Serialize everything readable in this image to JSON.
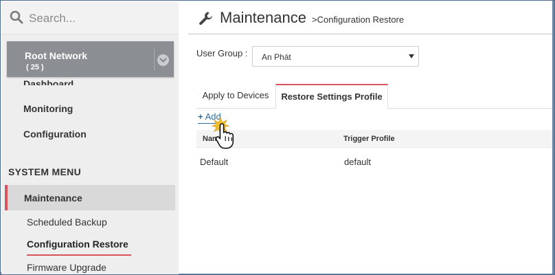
{
  "search": {
    "placeholder": "Search..."
  },
  "network": {
    "name": "Root Network",
    "count": "( 25 )"
  },
  "nav": {
    "dashboard": "Dashboard",
    "monitoring": "Monitoring",
    "configuration": "Configuration"
  },
  "system_menu": {
    "heading": "SYSTEM MENU",
    "maintenance": "Maintenance",
    "items": [
      "Scheduled Backup",
      "Configuration Restore",
      "Firmware Upgrade"
    ],
    "active_index": 1
  },
  "header": {
    "title": "Maintenance",
    "breadcrumb": ">Configuration Restore"
  },
  "user_group": {
    "label": "User Group :",
    "selected": "An Phát"
  },
  "tabs": [
    {
      "label": "Apply to Devices",
      "active": false
    },
    {
      "label": "Restore Settings Profile",
      "active": true
    }
  ],
  "add_label": "Add",
  "table": {
    "columns": [
      "Name",
      "Trigger Profile"
    ],
    "rows": [
      [
        "Default",
        "default"
      ]
    ]
  },
  "colors": {
    "accent": "#d9535f",
    "link": "#2d6b9f",
    "network_bg": "#8b8f94",
    "sidebar_bg": "#eeeeee"
  },
  "icons": {
    "search": "search-icon",
    "chevron": "chevron-down-circle-icon",
    "wrench": "wrench-icon",
    "caret": "caret-down-icon",
    "cursor": "hand-pointer-icon"
  }
}
